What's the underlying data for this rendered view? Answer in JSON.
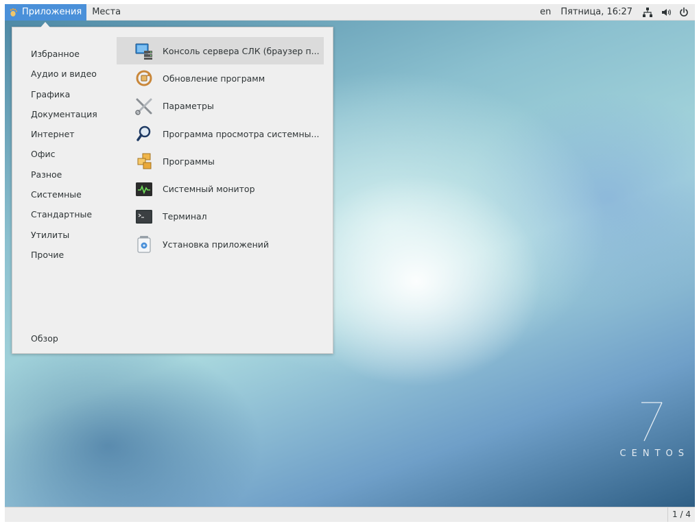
{
  "topbar": {
    "applications_label": "Приложения",
    "places_label": "Места",
    "keyboard_layout": "en",
    "clock": "Пятница, 16:27",
    "icons": [
      "network-icon",
      "volume-icon",
      "power-icon"
    ]
  },
  "menu": {
    "categories": [
      {
        "label": "Избранное"
      },
      {
        "label": "Аудио и видео"
      },
      {
        "label": "Графика"
      },
      {
        "label": "Документация"
      },
      {
        "label": "Интернет"
      },
      {
        "label": "Офис"
      },
      {
        "label": "Разное"
      },
      {
        "label": "Системные"
      },
      {
        "label": "Стандартные"
      },
      {
        "label": "Утилиты"
      },
      {
        "label": "Прочие"
      }
    ],
    "overview_label": "Обзор",
    "apps": [
      {
        "label": "Консоль сервера СЛК (браузер п...",
        "icon": "server-console-icon",
        "selected": true
      },
      {
        "label": "Обновление программ",
        "icon": "software-update-icon",
        "selected": false
      },
      {
        "label": "Параметры",
        "icon": "settings-tools-icon",
        "selected": false
      },
      {
        "label": "Программа просмотра системны...",
        "icon": "log-viewer-icon",
        "selected": false
      },
      {
        "label": "Программы",
        "icon": "software-icon",
        "selected": false
      },
      {
        "label": "Системный монитор",
        "icon": "system-monitor-icon",
        "selected": false
      },
      {
        "label": "Терминал",
        "icon": "terminal-icon",
        "selected": false
      },
      {
        "label": "Установка приложений",
        "icon": "package-installer-icon",
        "selected": false
      }
    ]
  },
  "desktop": {
    "logo_number": "7",
    "logo_text": "CENTOS"
  },
  "bottombar": {
    "workspace_indicator": "1 / 4"
  },
  "colors": {
    "accent": "#4a90d9",
    "panel": "#ececec",
    "menu_bg": "#efefef",
    "selected_row": "#dbdbdb"
  }
}
